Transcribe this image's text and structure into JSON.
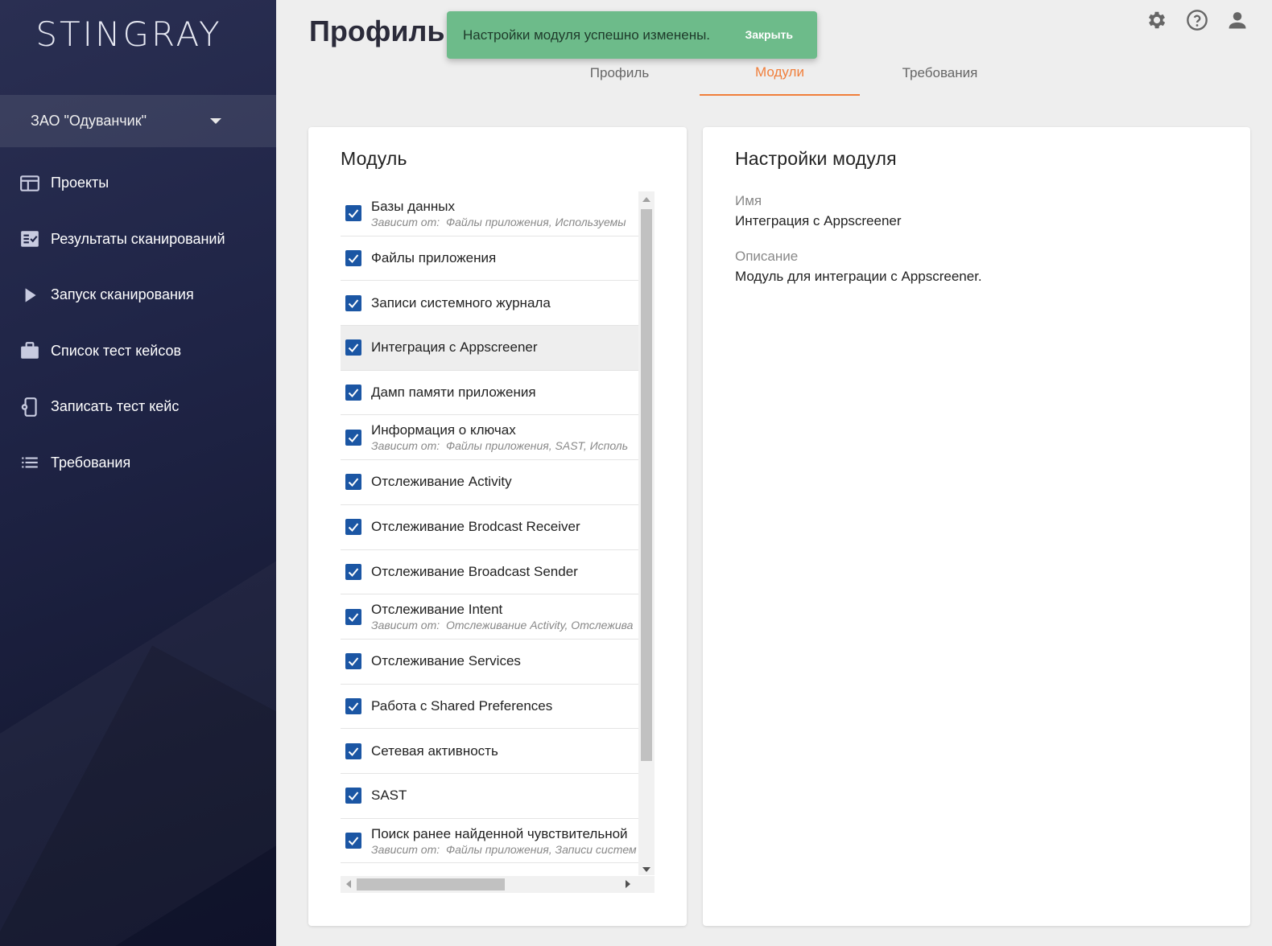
{
  "sidebar": {
    "logo": "STINGRAY",
    "org": "ЗАО \"Одуванчик\"",
    "items": [
      {
        "label": "Проекты",
        "icon": "projects-icon"
      },
      {
        "label": "Результаты сканирований",
        "icon": "results-icon"
      },
      {
        "label": "Запуск сканирования",
        "icon": "play-icon"
      },
      {
        "label": "Список тест кейсов",
        "icon": "briefcase-icon"
      },
      {
        "label": "Записать тест кейс",
        "icon": "phone-record-icon"
      },
      {
        "label": "Требования",
        "icon": "list-icon"
      }
    ]
  },
  "header": {
    "title": "Профиль",
    "toast": {
      "message": "Настройки модуля успешно изменены.",
      "close": "Закрыть",
      "color": "#6dbb8a"
    },
    "icons": [
      "settings-icon",
      "help-icon",
      "account-icon"
    ]
  },
  "tabs": [
    {
      "label": "Профиль",
      "active": false
    },
    {
      "label": "Модули",
      "active": true
    },
    {
      "label": "Требования",
      "active": false
    }
  ],
  "accent_color": "#f07e3a",
  "checkbox_color": "#1b56a4",
  "modules": {
    "title": "Модуль",
    "items": [
      {
        "label": "Базы данных",
        "dep_prefix": "Зависит от:",
        "dep": "Файлы приложения, Используемы",
        "checked": true
      },
      {
        "label": "Файлы приложения",
        "checked": true
      },
      {
        "label": "Записи системного журнала",
        "checked": true
      },
      {
        "label": "Интеграция с Appscreener",
        "checked": true,
        "highlighted": true
      },
      {
        "label": "Дамп памяти приложения",
        "checked": true
      },
      {
        "label": "Информация о ключах",
        "dep_prefix": "Зависит от:",
        "dep": "Файлы приложения, SAST, Исполь",
        "checked": true
      },
      {
        "label": "Отслеживание Activity",
        "checked": true
      },
      {
        "label": "Отслеживание Brodcast Receiver",
        "checked": true
      },
      {
        "label": "Отслеживание Broadcast Sender",
        "checked": true
      },
      {
        "label": "Отслеживание Intent",
        "dep_prefix": "Зависит от:",
        "dep": "Отслеживание Activity, Отслежива",
        "checked": true
      },
      {
        "label": "Отслеживание Services",
        "checked": true
      },
      {
        "label": "Работа с Shared Preferences",
        "checked": true
      },
      {
        "label": "Сетевая активность",
        "checked": true
      },
      {
        "label": "SAST",
        "checked": true
      },
      {
        "label": "Поиск ранее найденной чувствительной",
        "dep_prefix": "Зависит от:",
        "dep": "Файлы приложения, Записи систем",
        "checked": true
      }
    ]
  },
  "settings": {
    "title": "Настройки модуля",
    "name_label": "Имя",
    "name_value": "Интеграция с Appscreener",
    "desc_label": "Описание",
    "desc_value": "Модуль для интеграции с Appscreener."
  }
}
